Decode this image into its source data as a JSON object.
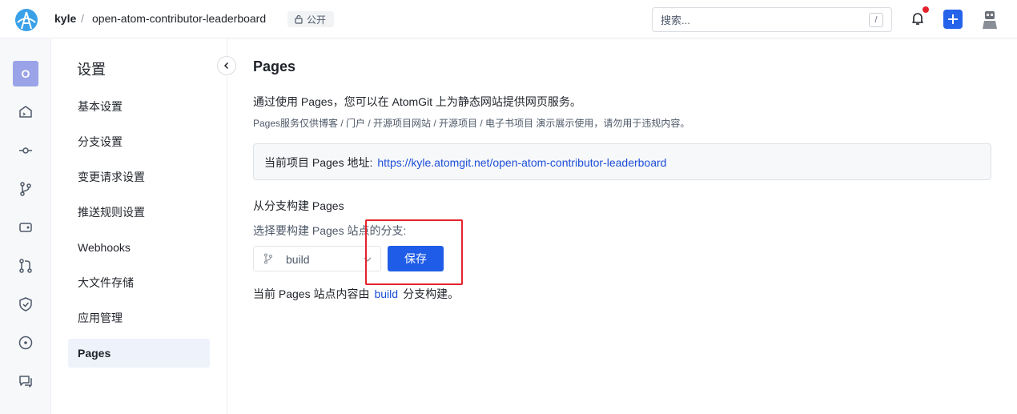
{
  "header": {
    "user": "kyle",
    "separator": "/",
    "repo": "open-atom-contributor-leaderboard",
    "visibility": "公开",
    "search_placeholder": "搜索...",
    "search_shortcut": "/"
  },
  "rail": {
    "project_initial": "O",
    "icons": [
      "code-icon",
      "commit-icon",
      "branch-icon",
      "tag-icon",
      "merge-request-icon",
      "security-icon",
      "issue-icon",
      "discussion-icon"
    ]
  },
  "sidebar": {
    "title": "设置",
    "items": [
      {
        "label": "基本设置"
      },
      {
        "label": "分支设置"
      },
      {
        "label": "变更请求设置"
      },
      {
        "label": "推送规则设置"
      },
      {
        "label": "Webhooks"
      },
      {
        "label": "大文件存储"
      },
      {
        "label": "应用管理"
      },
      {
        "label": "Pages"
      }
    ],
    "active": "Pages"
  },
  "main": {
    "title": "Pages",
    "description": "通过使用 Pages，您可以在 AtomGit 上为静态网站提供网页服务。",
    "note": "Pages服务仅供博客 / 门户 / 开源项目网站 / 开源项目 / 电子书项目 演示展示使用，请勿用于违规内容。",
    "address_label": "当前项目 Pages 地址:",
    "address_url": "https://kyle.atomgit.net/open-atom-contributor-leaderboard",
    "build_section_title": "从分支构建 Pages",
    "branch_select_label": "选择要构建 Pages 站点的分支:",
    "branch_value": "build",
    "save_label": "保存",
    "status_prefix": "当前 Pages 站点内容由",
    "status_branch": "build",
    "status_suffix": "分支构建。"
  },
  "colors": {
    "accent": "#1f5de8",
    "link": "#1d4ed8",
    "highlight": "#e5222c"
  }
}
